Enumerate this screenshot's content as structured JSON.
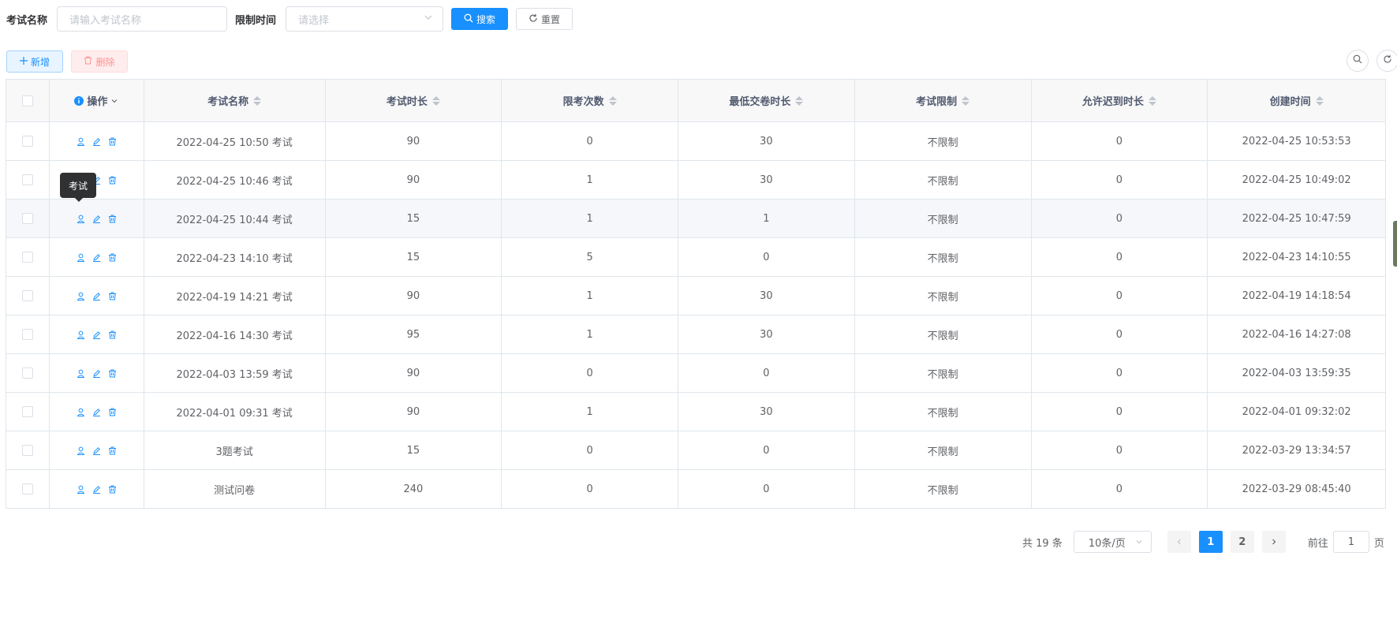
{
  "search": {
    "name_label": "考试名称",
    "name_placeholder": "请输入考试名称",
    "time_label": "限制时间",
    "time_placeholder": "请选择",
    "search_button": "搜索",
    "reset_button": "重置"
  },
  "toolbar": {
    "add_button": "新增",
    "delete_button": "删除"
  },
  "table": {
    "headers": [
      "操作",
      "考试名称",
      "考试时长",
      "限考次数",
      "最低交卷时长",
      "考试限制",
      "允许迟到时长",
      "创建时间"
    ],
    "rows": [
      {
        "name": "2022-04-25 10:50 考试",
        "duration": "90",
        "limit": "0",
        "min_submit": "30",
        "restrict": "不限制",
        "late": "0",
        "created": "2022-04-25 10:53:53"
      },
      {
        "name": "2022-04-25 10:46 考试",
        "duration": "90",
        "limit": "1",
        "min_submit": "30",
        "restrict": "不限制",
        "late": "0",
        "created": "2022-04-25 10:49:02"
      },
      {
        "name": "2022-04-25 10:44 考试",
        "duration": "15",
        "limit": "1",
        "min_submit": "1",
        "restrict": "不限制",
        "late": "0",
        "created": "2022-04-25 10:47:59"
      },
      {
        "name": "2022-04-23 14:10 考试",
        "duration": "15",
        "limit": "5",
        "min_submit": "0",
        "restrict": "不限制",
        "late": "0",
        "created": "2022-04-23 14:10:55"
      },
      {
        "name": "2022-04-19 14:21 考试",
        "duration": "90",
        "limit": "1",
        "min_submit": "30",
        "restrict": "不限制",
        "late": "0",
        "created": "2022-04-19 14:18:54"
      },
      {
        "name": "2022-04-16 14:30 考试",
        "duration": "95",
        "limit": "1",
        "min_submit": "30",
        "restrict": "不限制",
        "late": "0",
        "created": "2022-04-16 14:27:08"
      },
      {
        "name": "2022-04-03 13:59 考试",
        "duration": "90",
        "limit": "0",
        "min_submit": "0",
        "restrict": "不限制",
        "late": "0",
        "created": "2022-04-03 13:59:35"
      },
      {
        "name": "2022-04-01 09:31 考试",
        "duration": "90",
        "limit": "1",
        "min_submit": "30",
        "restrict": "不限制",
        "late": "0",
        "created": "2022-04-01 09:32:02"
      },
      {
        "name": "3题考试",
        "duration": "15",
        "limit": "0",
        "min_submit": "0",
        "restrict": "不限制",
        "late": "0",
        "created": "2022-03-29 13:34:57"
      },
      {
        "name": "测试问卷",
        "duration": "240",
        "limit": "0",
        "min_submit": "0",
        "restrict": "不限制",
        "late": "0",
        "created": "2022-03-29 08:45:40"
      }
    ]
  },
  "tooltip": "考试",
  "pagination": {
    "total": "共 19 条",
    "page_size": "10条/页",
    "pages": [
      "1",
      "2"
    ],
    "jump_prefix": "前往",
    "jump_value": "1",
    "jump_suffix": "页"
  },
  "colors": {
    "primary": "#1890ff",
    "danger": "#ff9292",
    "border": "#dfe6ec"
  }
}
